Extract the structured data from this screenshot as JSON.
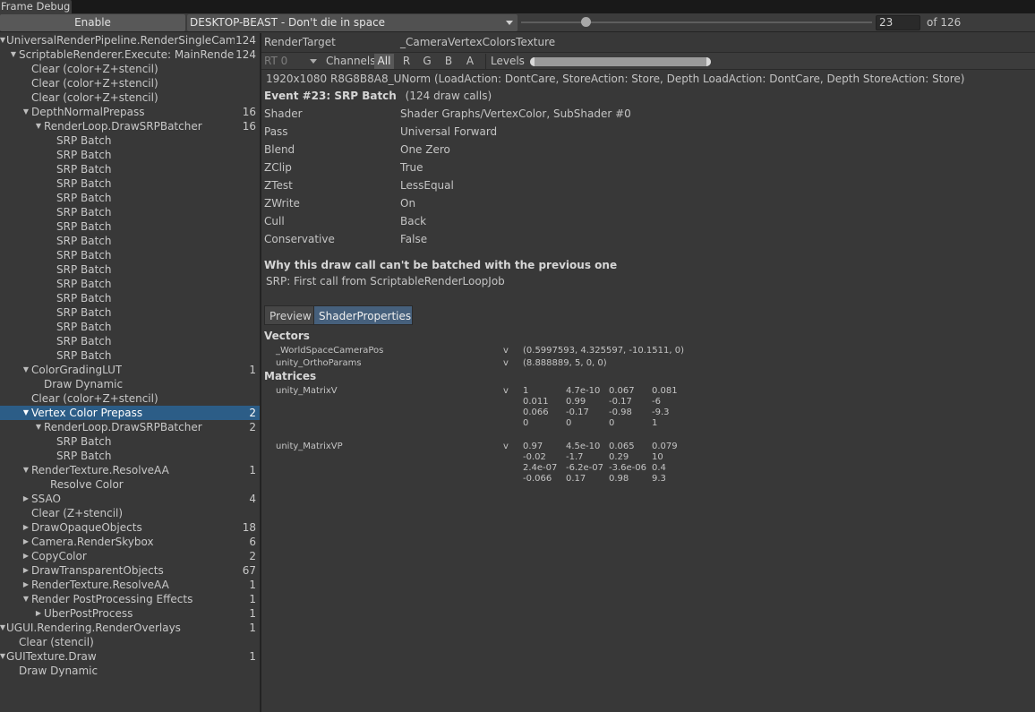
{
  "window": {
    "tab_title": "Frame Debug"
  },
  "toolbar": {
    "enable_label": "Enable",
    "target": "DESKTOP-BEAST - Don't die in space",
    "event_index": "23",
    "event_total": "of 126",
    "slider_position": 0.186
  },
  "tree": [
    {
      "label": "UniversalRenderPipeline.RenderSingleCamera",
      "count": "124",
      "depth": 0,
      "fold": "open"
    },
    {
      "label": "ScriptableRenderer.Execute: MainRenderer",
      "count": "124",
      "depth": 1,
      "fold": "open"
    },
    {
      "label": "Clear (color+Z+stencil)",
      "count": "",
      "depth": 2,
      "fold": "none"
    },
    {
      "label": "Clear (color+Z+stencil)",
      "count": "",
      "depth": 2,
      "fold": "none"
    },
    {
      "label": "Clear (color+Z+stencil)",
      "count": "",
      "depth": 2,
      "fold": "none"
    },
    {
      "label": "DepthNormalPrepass",
      "count": "16",
      "depth": 2,
      "fold": "open"
    },
    {
      "label": "RenderLoop.DrawSRPBatcher",
      "count": "16",
      "depth": 3,
      "fold": "open"
    },
    {
      "label": "SRP Batch",
      "count": "",
      "depth": 4,
      "fold": "none"
    },
    {
      "label": "SRP Batch",
      "count": "",
      "depth": 4,
      "fold": "none"
    },
    {
      "label": "SRP Batch",
      "count": "",
      "depth": 4,
      "fold": "none"
    },
    {
      "label": "SRP Batch",
      "count": "",
      "depth": 4,
      "fold": "none"
    },
    {
      "label": "SRP Batch",
      "count": "",
      "depth": 4,
      "fold": "none"
    },
    {
      "label": "SRP Batch",
      "count": "",
      "depth": 4,
      "fold": "none"
    },
    {
      "label": "SRP Batch",
      "count": "",
      "depth": 4,
      "fold": "none"
    },
    {
      "label": "SRP Batch",
      "count": "",
      "depth": 4,
      "fold": "none"
    },
    {
      "label": "SRP Batch",
      "count": "",
      "depth": 4,
      "fold": "none"
    },
    {
      "label": "SRP Batch",
      "count": "",
      "depth": 4,
      "fold": "none"
    },
    {
      "label": "SRP Batch",
      "count": "",
      "depth": 4,
      "fold": "none"
    },
    {
      "label": "SRP Batch",
      "count": "",
      "depth": 4,
      "fold": "none"
    },
    {
      "label": "SRP Batch",
      "count": "",
      "depth": 4,
      "fold": "none"
    },
    {
      "label": "SRP Batch",
      "count": "",
      "depth": 4,
      "fold": "none"
    },
    {
      "label": "SRP Batch",
      "count": "",
      "depth": 4,
      "fold": "none"
    },
    {
      "label": "SRP Batch",
      "count": "",
      "depth": 4,
      "fold": "none"
    },
    {
      "label": "ColorGradingLUT",
      "count": "1",
      "depth": 2,
      "fold": "open"
    },
    {
      "label": "Draw Dynamic",
      "count": "",
      "depth": 3,
      "fold": "none"
    },
    {
      "label": "Clear (color+Z+stencil)",
      "count": "",
      "depth": 2,
      "fold": "none"
    },
    {
      "label": "Vertex Color Prepass",
      "count": "2",
      "depth": 2,
      "fold": "open",
      "selected": true
    },
    {
      "label": "RenderLoop.DrawSRPBatcher",
      "count": "2",
      "depth": 3,
      "fold": "open"
    },
    {
      "label": "SRP Batch",
      "count": "",
      "depth": 4,
      "fold": "none"
    },
    {
      "label": "SRP Batch",
      "count": "",
      "depth": 4,
      "fold": "none"
    },
    {
      "label": "RenderTexture.ResolveAA",
      "count": "1",
      "depth": 2,
      "fold": "open"
    },
    {
      "label": "Resolve Color",
      "count": "",
      "depth": 3.5,
      "fold": "none"
    },
    {
      "label": "SSAO",
      "count": "4",
      "depth": 2,
      "fold": "closed"
    },
    {
      "label": "Clear (Z+stencil)",
      "count": "",
      "depth": 2,
      "fold": "none"
    },
    {
      "label": "DrawOpaqueObjects",
      "count": "18",
      "depth": 2,
      "fold": "closed"
    },
    {
      "label": "Camera.RenderSkybox",
      "count": "6",
      "depth": 2,
      "fold": "closed"
    },
    {
      "label": "CopyColor",
      "count": "2",
      "depth": 2,
      "fold": "closed"
    },
    {
      "label": "DrawTransparentObjects",
      "count": "67",
      "depth": 2,
      "fold": "closed"
    },
    {
      "label": "RenderTexture.ResolveAA",
      "count": "1",
      "depth": 2,
      "fold": "closed"
    },
    {
      "label": "Render PostProcessing Effects",
      "count": "1",
      "depth": 2,
      "fold": "open"
    },
    {
      "label": "UberPostProcess",
      "count": "1",
      "depth": 3,
      "fold": "closed"
    },
    {
      "label": "UGUI.Rendering.RenderOverlays",
      "count": "1",
      "depth": 0,
      "fold": "open"
    },
    {
      "label": "Clear (stencil)",
      "count": "",
      "depth": 1,
      "fold": "none"
    },
    {
      "label": "GUITexture.Draw",
      "count": "1",
      "depth": 0,
      "fold": "open"
    },
    {
      "label": "Draw Dynamic",
      "count": "",
      "depth": 1,
      "fold": "none"
    }
  ],
  "details": {
    "render_target_label": "RenderTarget",
    "render_target_value": "_CameraVertexColorsTexture",
    "rt_select": "RT 0",
    "channels_label": "Channels",
    "channels": [
      "All",
      "R",
      "G",
      "B",
      "A"
    ],
    "levels_label": "Levels",
    "format_line": "1920x1080 R8G8B8A8_UNorm (LoadAction: DontCare, StoreAction: Store, Depth LoadAction: DontCare, Depth StoreAction: Store)",
    "event_title": "Event #23: SRP Batch",
    "event_calls": "(124 draw calls)",
    "props": [
      {
        "key": "Shader",
        "value": "Shader Graphs/VertexColor, SubShader #0"
      },
      {
        "key": "Pass",
        "value": "Universal Forward"
      },
      {
        "key": "Blend",
        "value": "One Zero"
      },
      {
        "key": "ZClip",
        "value": "True"
      },
      {
        "key": "ZTest",
        "value": "LessEqual"
      },
      {
        "key": "ZWrite",
        "value": "On"
      },
      {
        "key": "Cull",
        "value": "Back"
      },
      {
        "key": "Conservative",
        "value": "False"
      }
    ],
    "batch_title": "Why this draw call can't be batched with the previous one",
    "batch_reason": "SRP: First call from ScriptableRenderLoopJob",
    "tabs": [
      "Preview",
      "ShaderProperties"
    ],
    "vectors_title": "Vectors",
    "vectors": [
      {
        "name": "_WorldSpaceCameraPos",
        "stage": "v",
        "value": "(0.5997593, 4.325597, -10.1511, 0)"
      },
      {
        "name": "unity_OrthoParams",
        "stage": "v",
        "value": "(8.888889, 5, 0, 0)"
      }
    ],
    "matrices_title": "Matrices",
    "matrices": [
      {
        "name": "unity_MatrixV",
        "stage": "v",
        "rows": [
          [
            "1",
            "4.7e-10",
            "0.067",
            "0.081"
          ],
          [
            "0.011",
            "0.99",
            "-0.17",
            "-6"
          ],
          [
            "0.066",
            "-0.17",
            "-0.98",
            "-9.3"
          ],
          [
            "0",
            "0",
            "0",
            "1"
          ]
        ]
      },
      {
        "name": "unity_MatrixVP",
        "stage": "v",
        "rows": [
          [
            "0.97",
            "4.5e-10",
            "0.065",
            "0.079"
          ],
          [
            "-0.02",
            "-1.7",
            "0.29",
            "10"
          ],
          [
            "2.4e-07",
            "-6.2e-07",
            "-3.6e-06",
            "0.4"
          ],
          [
            "-0.066",
            "0.17",
            "0.98",
            "9.3"
          ]
        ]
      }
    ]
  }
}
